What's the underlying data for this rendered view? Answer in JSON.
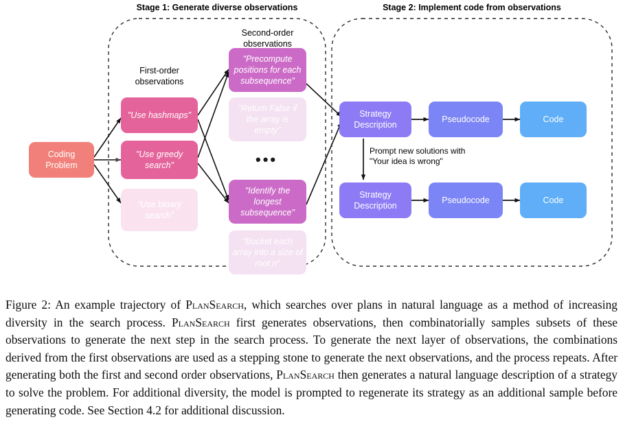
{
  "stages": [
    {
      "id": "stage-1",
      "title": "Stage 1: Generate diverse observations"
    },
    {
      "id": "stage-2",
      "title": "Stage 2: Implement code from observations"
    }
  ],
  "column_labels": {
    "first_order": "First-order\nobservations",
    "second_order": "Second-order\nobservations"
  },
  "problem_node": {
    "label": "Coding Problem",
    "color": "#F08079"
  },
  "first_order_observations": [
    {
      "label": "\"Use hashmaps\"",
      "color": "#E5639B",
      "faded": false
    },
    {
      "label": "\"Use greedy\nsearch\"",
      "color": "#E5639B",
      "faded": false
    },
    {
      "label": "\"Use binary\nsearch\"",
      "color": "#FAE3EF",
      "faded": true
    }
  ],
  "second_order_observations": [
    {
      "label": "\"Precompute\npositions for each\nsubsequence\"",
      "color": "#CB6BC7",
      "faded": false
    },
    {
      "label": "\"Return False if\nthe array is\nempty\"",
      "color": "#F4E1F2",
      "faded": true
    },
    {
      "label": "\"Identify the\nlongest\nsubsequence\"",
      "color": "#CB6BC7",
      "faded": false
    },
    {
      "label": "\"Bucket each\narray into a size\nof root n\"",
      "color": "#F4E1F2",
      "faded": true
    }
  ],
  "ellipsis": "•••",
  "pipelines": [
    {
      "strategy": {
        "label": "Strategy\nDescription",
        "color": "#8C7BF5"
      },
      "pseudocode": {
        "label": "Pseudocode",
        "color": "#7B85F5"
      },
      "code": {
        "label": "Code",
        "color": "#5FAEF7"
      }
    },
    {
      "strategy": {
        "label": "Strategy\nDescription",
        "color": "#8C7BF5"
      },
      "pseudocode": {
        "label": "Pseudocode",
        "color": "#7B85F5"
      },
      "code": {
        "label": "Code",
        "color": "#5FAEF7"
      }
    }
  ],
  "regenerate_edge_label": "Prompt new solutions with\n\"Your idea is wrong\"",
  "caption": {
    "prefix": "Figure 2: An example trajectory of ",
    "name_1": "PlanSearch",
    "mid_1": ", which searches over plans in natural language as a method of increasing diversity in the search process. ",
    "name_2": "PlanSearch",
    "mid_2": " first generates observations, then combinatorially samples subsets of these observations to generate the next step in the search process. To generate the next layer of observations, the combinations derived from the first observations are used as a stepping stone to generate the next observations, and the process repeats. After generating both the first and second order observations, ",
    "name_3": "PlanSearch",
    "suffix": " then generates a natural language description of a strategy to solve the problem. For additional diversity, the model is prompted to regenerate its strategy as an additional sample before generating code. See Section 4.2 for additional discussion."
  }
}
